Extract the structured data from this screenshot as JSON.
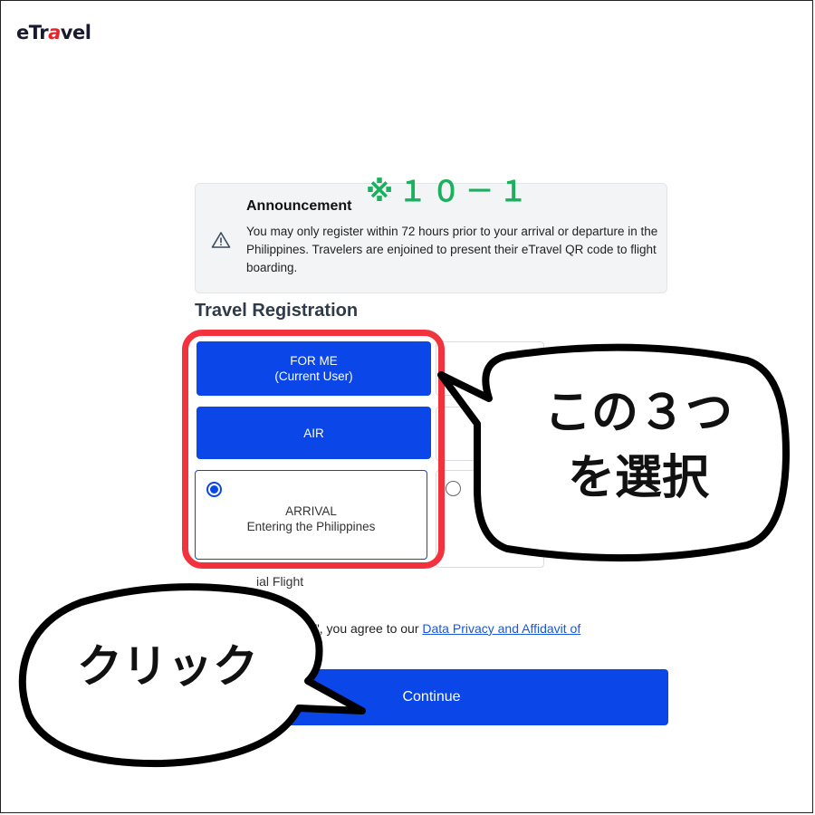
{
  "header": {
    "logo": "eTravel",
    "logo_parts": [
      "eTr",
      "a",
      "vel"
    ]
  },
  "annotation_code": "※１０－１",
  "announcement": {
    "title": "Announcement",
    "body": "You may only register within 72 hours prior to your arrival or departure in the Philippines. Travelers are enjoined to present their eTravel QR code to flight boarding.",
    "icon": "warning-triangle-icon"
  },
  "registration": {
    "title": "Travel Registration",
    "for_me_line1": "FOR ME",
    "for_me_line2": "(Current User)",
    "air": "AIR",
    "arrival_line1": "ARRIVAL",
    "arrival_line2": "Entering the Philippines",
    "special_flight": "ial Flight",
    "agree_prefix": "e\", you agree to our ",
    "agree_link": "Data Privacy and Affidavit of"
  },
  "continue_label": "Continue",
  "callouts": {
    "select_line1": "この３つ",
    "select_line2": "を選択",
    "click": "クリック"
  },
  "colors": {
    "primary": "#0a46e8",
    "highlight_red": "#f2333d",
    "annotation_green": "#19b15d",
    "announcement_bg": "#f3f4f6"
  }
}
